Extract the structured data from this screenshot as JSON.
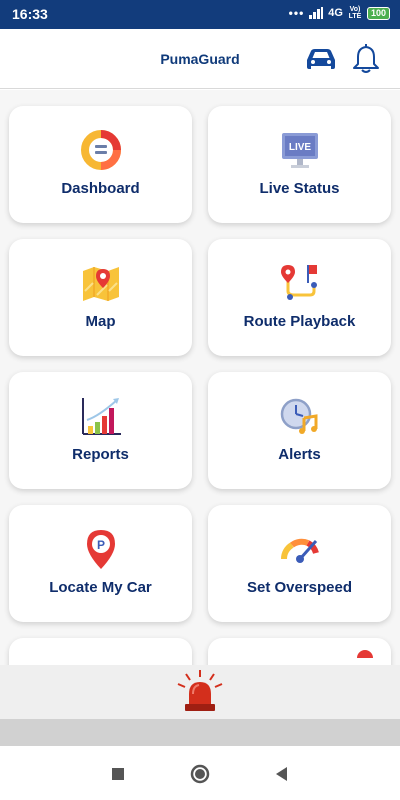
{
  "status_bar": {
    "time": "16:33",
    "network": "4G",
    "volte_top": "Vo)",
    "volte_bottom": "LTE",
    "battery": "100"
  },
  "app_bar": {
    "title": "PumaGuard",
    "icons": [
      "car-icon",
      "bell-icon"
    ]
  },
  "menu": [
    {
      "label": "Dashboard",
      "icon": "dashboard-donut-icon"
    },
    {
      "label": "Live Status",
      "icon": "live-monitor-icon"
    },
    {
      "label": "Map",
      "icon": "map-pin-icon"
    },
    {
      "label": "Route Playback",
      "icon": "route-icon"
    },
    {
      "label": "Reports",
      "icon": "bar-chart-icon"
    },
    {
      "label": "Alerts",
      "icon": "clock-note-icon"
    },
    {
      "label": "Locate My Car",
      "icon": "parking-pin-icon"
    },
    {
      "label": "Set Overspeed",
      "icon": "speedometer-icon"
    }
  ],
  "footer": {
    "icon": "siren-icon"
  },
  "nav_bar": [
    "square-icon",
    "circle-icon",
    "back-triangle-icon"
  ],
  "colors": {
    "status_bar": "#123c7c",
    "title": "#0f3a7a",
    "label": "#0f2d6b",
    "background": "#f6f6f6",
    "siren": "#d32f1c"
  }
}
